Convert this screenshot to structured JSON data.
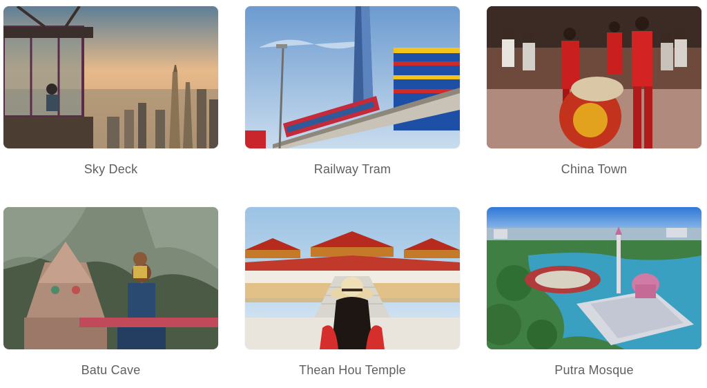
{
  "attractions": [
    {
      "title": "Sky Deck"
    },
    {
      "title": "Railway Tram"
    },
    {
      "title": "China Town"
    },
    {
      "title": "Batu Cave"
    },
    {
      "title": "Thean Hou Temple"
    },
    {
      "title": "Putra Mosque"
    }
  ],
  "colors": {
    "caption_text": "#5f5f5f",
    "background": "#ffffff"
  }
}
